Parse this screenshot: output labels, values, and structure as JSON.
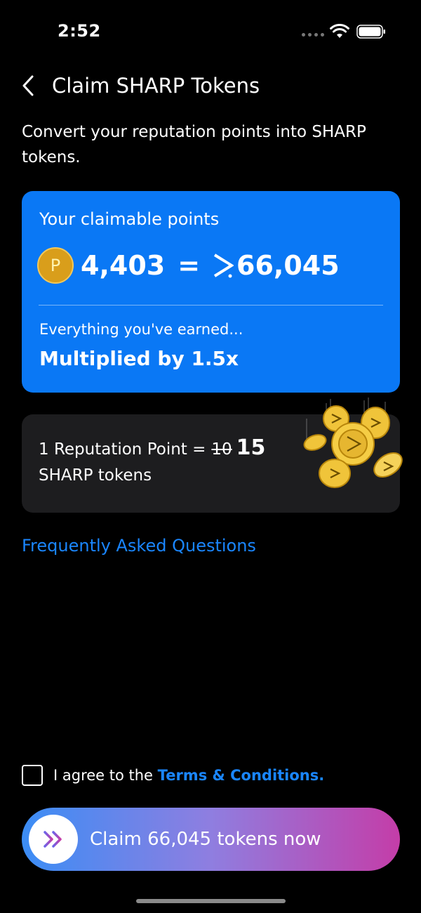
{
  "status_bar": {
    "time": "2:52"
  },
  "header": {
    "title": "Claim SHARP Tokens"
  },
  "subtitle": "Convert your reputation points into SHARP tokens.",
  "points_card": {
    "label": "Your claimable points",
    "coin_letter": "P",
    "points": "4,403",
    "equals": "=",
    "tokens": "66,045",
    "earned_text": "Everything you've earned...",
    "multiplier_text": "Multiplied by 1.5x"
  },
  "rate_card": {
    "prefix": "1 Reputation Point =",
    "old_rate": "10",
    "new_rate": "15",
    "suffix": "SHARP tokens"
  },
  "faq_link": "Frequently Asked Questions",
  "terms": {
    "prefix": "I agree to the",
    "link": "Terms & Conditions.",
    "checked": false
  },
  "claim_button": {
    "label": "Claim 66,045 tokens now"
  },
  "colors": {
    "background": "#000000",
    "card_blue": "#0a78f5",
    "card_dark": "#1d1d1f",
    "link_blue": "#1a86ff",
    "gradient_start": "#3b8df5",
    "gradient_end": "#c43da8",
    "coin_gold": "#e6b630"
  }
}
